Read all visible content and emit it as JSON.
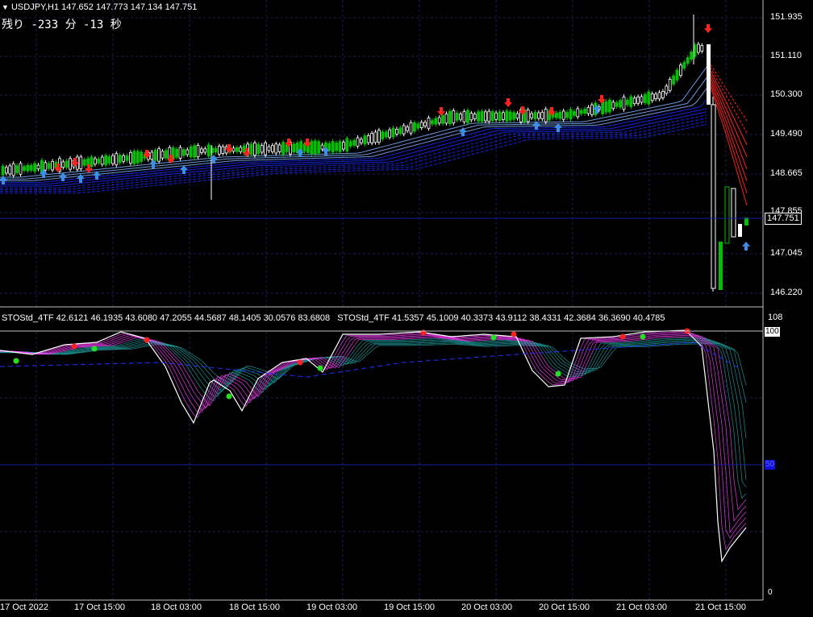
{
  "chart": {
    "symbol_header": "USDJPY,H1  147.652 147.773 147.134 147.751",
    "countdown": "残り -233 分 -13 秒",
    "current_price": "147.751",
    "price_axis": [
      "151.935",
      "151.110",
      "150.300",
      "149.490",
      "148.665",
      "147.855",
      "147.045",
      "146.220"
    ],
    "colors": {
      "bull": "#00c000",
      "bear": "#ffffff",
      "grid": "#1c1c5a",
      "level": "#1a1aa8",
      "up_arrow": "#3a8ee6",
      "down_arrow": "#ff2020"
    }
  },
  "indicator": {
    "headers": [
      "STOStd_4TF 42.6121 46.1935 43.6080 47.2055 44.5687 48.1405 30.0576 83.6808",
      "STOStd_4TF 41.5357 45.1009 40.3373 43.9112 38.4331 42.3684 36.3690 40.4785"
    ],
    "scale_top": "108",
    "level_100": "100",
    "level_50": "50",
    "scale_bottom": "0",
    "colors": {
      "main": "#ffffff",
      "fast": "#ff40ff",
      "slow": "#20a0a0",
      "dot_red": "#ff2020",
      "dot_green": "#20e020"
    }
  },
  "time_axis": [
    "17 Oct 2022",
    "17 Oct 15:00",
    "18 Oct 03:00",
    "18 Oct 15:00",
    "19 Oct 03:00",
    "19 Oct 15:00",
    "20 Oct 03:00",
    "20 Oct 15:00",
    "21 Oct 03:00",
    "21 Oct 15:00"
  ]
}
